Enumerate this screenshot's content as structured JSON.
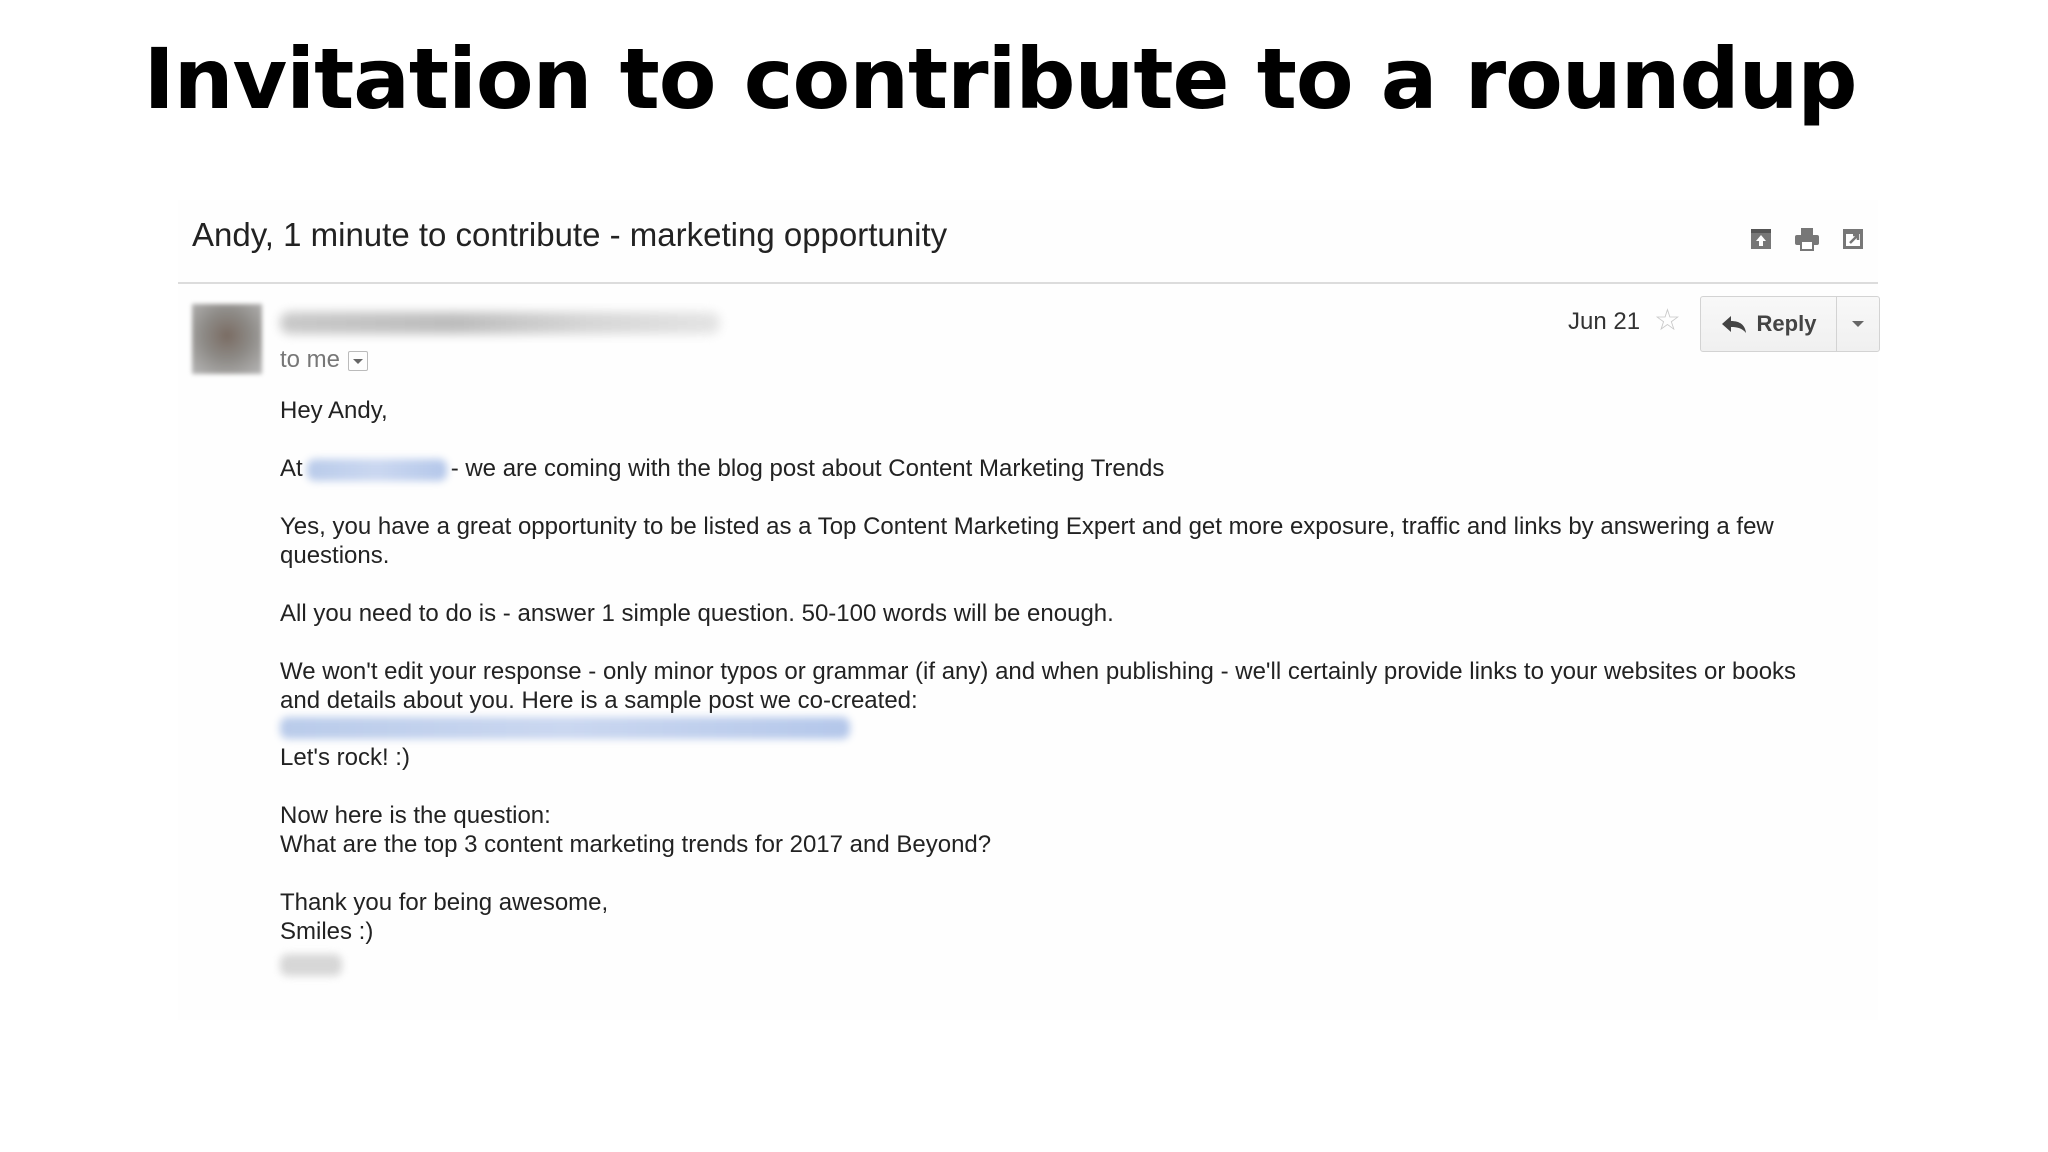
{
  "slide": {
    "title": "Invitation to contribute to a roundup"
  },
  "email": {
    "subject": "Andy, 1 minute to contribute - marketing opportunity",
    "top_icons": [
      "archive-icon",
      "print-icon",
      "new-window-icon"
    ],
    "recipient_line": "to me",
    "date": "Jun 21",
    "star_icon": "star-icon",
    "reply_label": "Reply",
    "body": {
      "greeting": "Hey Andy,",
      "line1_prefix": "At",
      "line1_rest": "- we are coming with the blog post about Content Marketing Trends",
      "para2": "Yes, you have a great opportunity to be listed as a Top Content Marketing Expert and get more exposure, traffic and links by answering a few questions.",
      "para3": "All you need to do is - answer 1 simple question. 50-100 words will be enough.",
      "para4": "We won't edit your response - only minor typos or grammar (if any) and when publishing - we'll certainly provide links to your websites or books and details about you. Here is a sample post we co-created:",
      "lets_rock": "Let's rock! :)",
      "question_intro": "Now here is the question:",
      "question": "What are the top 3 content marketing trends for 2017 and Beyond?",
      "thanks": "Thank you for being awesome,",
      "smiles": "Smiles :)"
    }
  }
}
